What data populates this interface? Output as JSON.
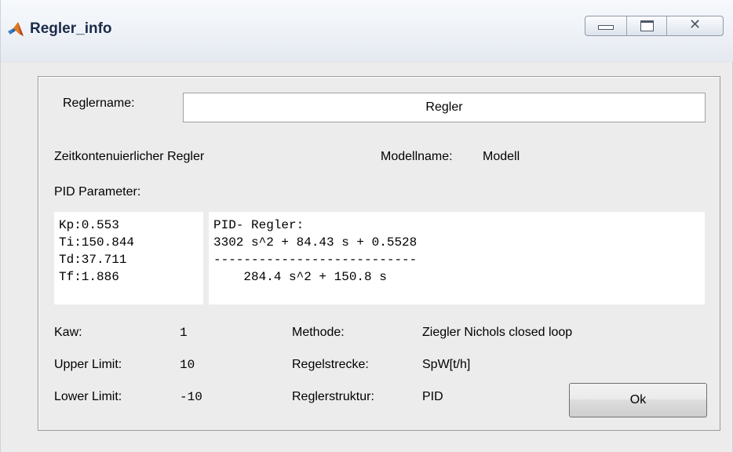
{
  "window": {
    "title": "Regler_info",
    "icon": "matlab-logo-icon",
    "close_glyph": "✕"
  },
  "form": {
    "reglername_label": "Reglername:",
    "reglername_value": "Regler",
    "controller_type": "Zeitkontenuierlicher Regler",
    "modellname_label": "Modellname:",
    "modellname_value": "Modell",
    "pid_parameter_label": "PID Parameter:",
    "parameters": [
      "Kp:0.553",
      "Ti:150.844",
      "Td:37.711",
      "Tf:1.886"
    ],
    "transfer_function": {
      "header": "PID- Regler:",
      "numerator": "3302 s^2 + 84.43 s + 0.5528",
      "fraction_bar": "---------------------------",
      "denominator": "    284.4 s^2 + 150.8 s"
    },
    "kaw_label": "Kaw:",
    "kaw_value": "1",
    "upper_limit_label": "Upper Limit:",
    "upper_limit_value": "10",
    "lower_limit_label": "Lower Limit:",
    "lower_limit_value": "-10",
    "methode_label": "Methode:",
    "methode_value": "Ziegler Nichols closed loop",
    "regelstrecke_label": "Regelstrecke:",
    "regelstrecke_value": "SpW[t/h]",
    "reglerstruktur_label": "Reglerstruktur:",
    "reglerstruktur_value": "PID",
    "ok_label": "Ok"
  }
}
